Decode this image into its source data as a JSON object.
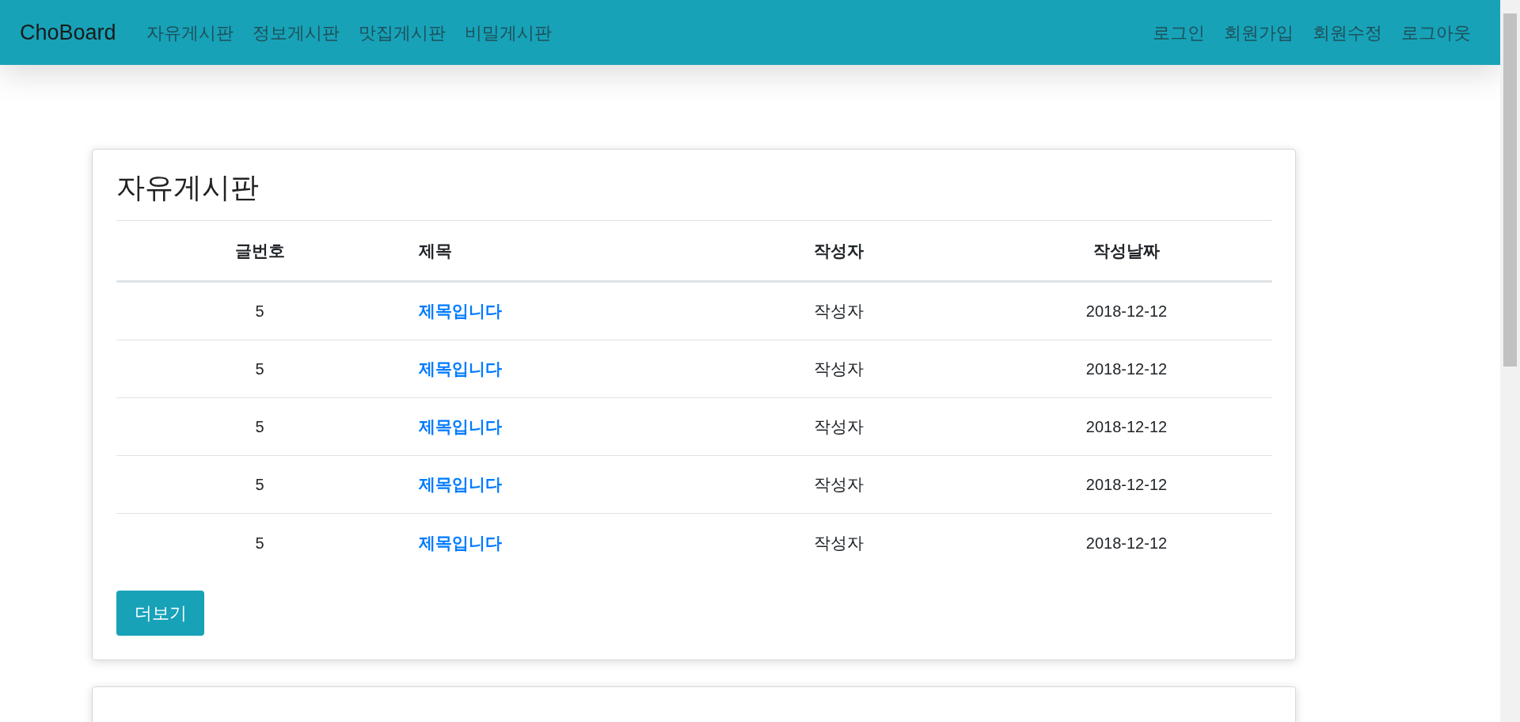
{
  "navbar": {
    "brand": "ChoBoard",
    "left_links": [
      "자유게시판",
      "정보게시판",
      "맛집게시판",
      "비밀게시판"
    ],
    "right_links": [
      "로그인",
      "회원가입",
      "회원수정",
      "로그아웃"
    ]
  },
  "boards": [
    {
      "title": "자유게시판",
      "columns": [
        "글번호",
        "제목",
        "작성자",
        "작성날짜"
      ],
      "rows": [
        {
          "number": "5",
          "title": "제목입니다",
          "author": "작성자",
          "date": "2018-12-12"
        },
        {
          "number": "5",
          "title": "제목입니다",
          "author": "작성자",
          "date": "2018-12-12"
        },
        {
          "number": "5",
          "title": "제목입니다",
          "author": "작성자",
          "date": "2018-12-12"
        },
        {
          "number": "5",
          "title": "제목입니다",
          "author": "작성자",
          "date": "2018-12-12"
        },
        {
          "number": "5",
          "title": "제목입니다",
          "author": "작성자",
          "date": "2018-12-12"
        }
      ],
      "more_button": "더보기"
    },
    {
      "kind": "card"
    }
  ]
}
